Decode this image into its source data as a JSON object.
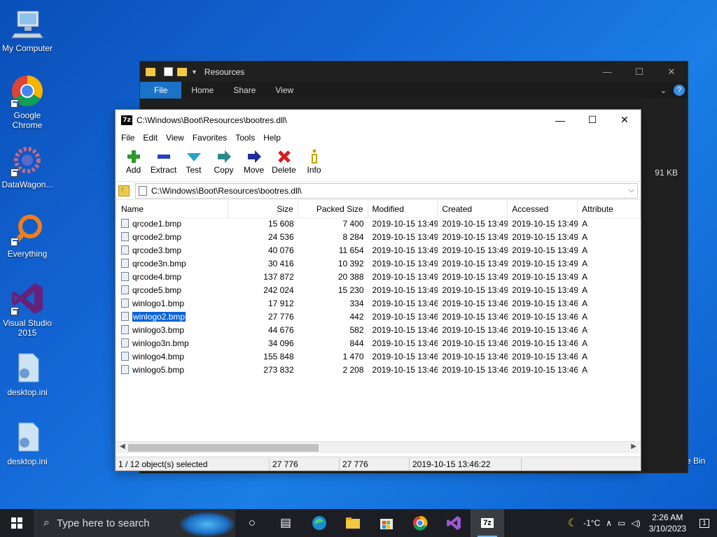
{
  "desktop": {
    "icons": [
      {
        "label": "My Computer"
      },
      {
        "label": "Google Chrome"
      },
      {
        "label": "DataWagon..."
      },
      {
        "label": "Everything"
      },
      {
        "label": "Visual Studio 2015"
      },
      {
        "label": "desktop.ini"
      },
      {
        "label": "desktop.ini"
      }
    ],
    "recycle_label": "e Bin"
  },
  "explorer": {
    "title": "Resources",
    "tabs": [
      "File",
      "Home",
      "Share",
      "View"
    ],
    "size_text": "91 KB",
    "help": "?"
  },
  "zip": {
    "title": "C:\\Windows\\Boot\\Resources\\bootres.dll\\",
    "app_icon": "7z",
    "menu": [
      "File",
      "Edit",
      "View",
      "Favorites",
      "Tools",
      "Help"
    ],
    "toolbar": [
      {
        "label": "Add",
        "icon": "plus-icon",
        "color": "#2e9a2e"
      },
      {
        "label": "Extract",
        "icon": "minus-icon",
        "color": "#2a3fbf"
      },
      {
        "label": "Test",
        "icon": "check-icon",
        "color": "#23a6c4"
      },
      {
        "label": "Copy",
        "icon": "copy-arrow-icon",
        "color": "#2c8a8a"
      },
      {
        "label": "Move",
        "icon": "move-arrow-icon",
        "color": "#1e2f9a"
      },
      {
        "label": "Delete",
        "icon": "x-icon",
        "color": "#d21f1f"
      },
      {
        "label": "Info",
        "icon": "info-icon",
        "color": "#c8a400"
      }
    ],
    "address": "C:\\Windows\\Boot\\Resources\\bootres.dll\\",
    "columns": [
      "Name",
      "Size",
      "Packed Size",
      "Modified",
      "Created",
      "Accessed",
      "Attribute"
    ],
    "files": [
      {
        "name": "qrcode1.bmp",
        "size": "15 608",
        "packed": "7 400",
        "modified": "2019-10-15 13:49",
        "created": "2019-10-15 13:49",
        "accessed": "2019-10-15 13:49",
        "attr": "A"
      },
      {
        "name": "qrcode2.bmp",
        "size": "24 536",
        "packed": "8 284",
        "modified": "2019-10-15 13:49",
        "created": "2019-10-15 13:49",
        "accessed": "2019-10-15 13:49",
        "attr": "A"
      },
      {
        "name": "qrcode3.bmp",
        "size": "40 076",
        "packed": "11 654",
        "modified": "2019-10-15 13:49",
        "created": "2019-10-15 13:49",
        "accessed": "2019-10-15 13:49",
        "attr": "A"
      },
      {
        "name": "qrcode3n.bmp",
        "size": "30 416",
        "packed": "10 392",
        "modified": "2019-10-15 13:49",
        "created": "2019-10-15 13:49",
        "accessed": "2019-10-15 13:49",
        "attr": "A"
      },
      {
        "name": "qrcode4.bmp",
        "size": "137 872",
        "packed": "20 388",
        "modified": "2019-10-15 13:49",
        "created": "2019-10-15 13:49",
        "accessed": "2019-10-15 13:49",
        "attr": "A"
      },
      {
        "name": "qrcode5.bmp",
        "size": "242 024",
        "packed": "15 230",
        "modified": "2019-10-15 13:49",
        "created": "2019-10-15 13:49",
        "accessed": "2019-10-15 13:49",
        "attr": "A"
      },
      {
        "name": "winlogo1.bmp",
        "size": "17 912",
        "packed": "334",
        "modified": "2019-10-15 13:46",
        "created": "2019-10-15 13:46",
        "accessed": "2019-10-15 13:46",
        "attr": "A"
      },
      {
        "name": "winlogo2.bmp",
        "size": "27 776",
        "packed": "442",
        "modified": "2019-10-15 13:46",
        "created": "2019-10-15 13:46",
        "accessed": "2019-10-15 13:46",
        "attr": "A",
        "selected": true
      },
      {
        "name": "winlogo3.bmp",
        "size": "44 676",
        "packed": "582",
        "modified": "2019-10-15 13:46",
        "created": "2019-10-15 13:46",
        "accessed": "2019-10-15 13:46",
        "attr": "A"
      },
      {
        "name": "winlogo3n.bmp",
        "size": "34 096",
        "packed": "844",
        "modified": "2019-10-15 13:46",
        "created": "2019-10-15 13:46",
        "accessed": "2019-10-15 13:46",
        "attr": "A"
      },
      {
        "name": "winlogo4.bmp",
        "size": "155 848",
        "packed": "1 470",
        "modified": "2019-10-15 13:46",
        "created": "2019-10-15 13:46",
        "accessed": "2019-10-15 13:46",
        "attr": "A"
      },
      {
        "name": "winlogo5.bmp",
        "size": "273 832",
        "packed": "2 208",
        "modified": "2019-10-15 13:46",
        "created": "2019-10-15 13:46",
        "accessed": "2019-10-15 13:46",
        "attr": "A"
      }
    ],
    "status": {
      "selection": "1 / 12 object(s) selected",
      "size": "27 776",
      "packed": "27 776",
      "date": "2019-10-15 13:46:22"
    }
  },
  "taskbar": {
    "search_placeholder": "Type here to search",
    "weather": "-1°C",
    "time": "2:26 AM",
    "date": "3/10/2023",
    "notifications": "1"
  }
}
